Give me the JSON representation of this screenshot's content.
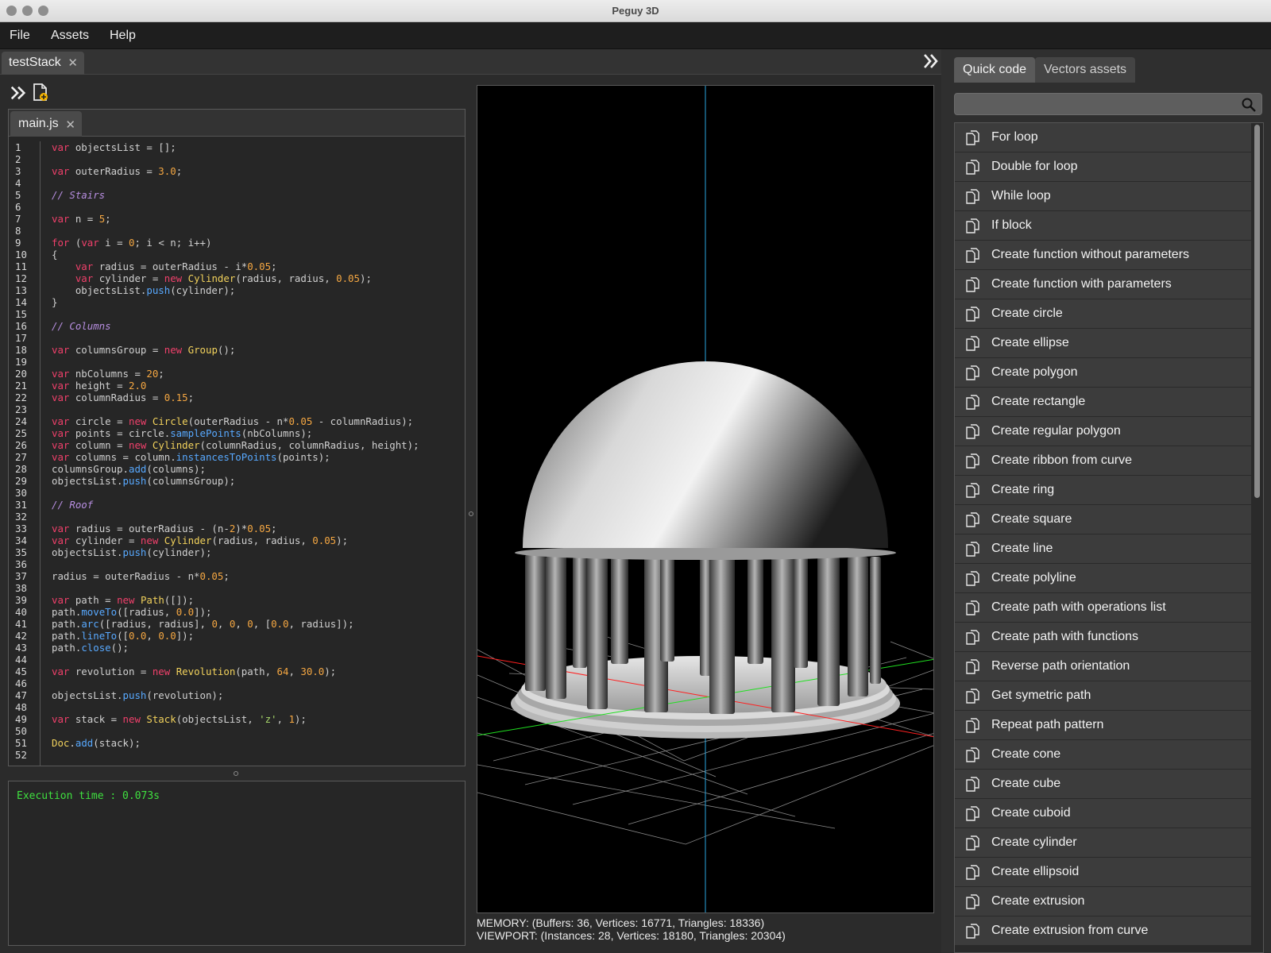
{
  "window": {
    "title": "Peguy 3D"
  },
  "menu": [
    "File",
    "Assets",
    "Help"
  ],
  "stack_tab": {
    "label": "testStack",
    "close": "✕"
  },
  "editor": {
    "file_tab": "main.js",
    "close": "✕",
    "lines": [
      [
        [
          "kw",
          "var"
        ],
        [
          "t",
          " objectsList = [];"
        ]
      ],
      [],
      [
        [
          "kw",
          "var"
        ],
        [
          "t",
          " outerRadius = "
        ],
        [
          "num",
          "3.0"
        ],
        [
          "t",
          ";"
        ]
      ],
      [],
      [
        [
          "cmt",
          "// Stairs"
        ]
      ],
      [],
      [
        [
          "kw",
          "var"
        ],
        [
          "t",
          " n = "
        ],
        [
          "num",
          "5"
        ],
        [
          "t",
          ";"
        ]
      ],
      [],
      [
        [
          "kw",
          "for"
        ],
        [
          "t",
          " ("
        ],
        [
          "kw",
          "var"
        ],
        [
          "t",
          " i = "
        ],
        [
          "num",
          "0"
        ],
        [
          "t",
          "; i < n; i++)"
        ]
      ],
      [
        [
          "t",
          "{"
        ]
      ],
      [
        [
          "t",
          "    "
        ],
        [
          "kw",
          "var"
        ],
        [
          "t",
          " radius = outerRadius - i*"
        ],
        [
          "num",
          "0.05"
        ],
        [
          "t",
          ";"
        ]
      ],
      [
        [
          "t",
          "    "
        ],
        [
          "kw",
          "var"
        ],
        [
          "t",
          " cylinder = "
        ],
        [
          "kw",
          "new"
        ],
        [
          "t",
          " "
        ],
        [
          "cls",
          "Cylinder"
        ],
        [
          "t",
          "(radius, radius, "
        ],
        [
          "num",
          "0.05"
        ],
        [
          "t",
          ");"
        ]
      ],
      [
        [
          "t",
          "    objectsList."
        ],
        [
          "fn",
          "push"
        ],
        [
          "t",
          "(cylinder);"
        ]
      ],
      [
        [
          "t",
          "}"
        ]
      ],
      [],
      [
        [
          "cmt",
          "// Columns"
        ]
      ],
      [],
      [
        [
          "kw",
          "var"
        ],
        [
          "t",
          " columnsGroup = "
        ],
        [
          "kw",
          "new"
        ],
        [
          "t",
          " "
        ],
        [
          "cls",
          "Group"
        ],
        [
          "t",
          "();"
        ]
      ],
      [],
      [
        [
          "kw",
          "var"
        ],
        [
          "t",
          " nbColumns = "
        ],
        [
          "num",
          "20"
        ],
        [
          "t",
          ";"
        ]
      ],
      [
        [
          "kw",
          "var"
        ],
        [
          "t",
          " height = "
        ],
        [
          "num",
          "2.0"
        ]
      ],
      [
        [
          "kw",
          "var"
        ],
        [
          "t",
          " columnRadius = "
        ],
        [
          "num",
          "0.15"
        ],
        [
          "t",
          ";"
        ]
      ],
      [],
      [
        [
          "kw",
          "var"
        ],
        [
          "t",
          " circle = "
        ],
        [
          "kw",
          "new"
        ],
        [
          "t",
          " "
        ],
        [
          "cls",
          "Circle"
        ],
        [
          "t",
          "(outerRadius - n*"
        ],
        [
          "num",
          "0.05"
        ],
        [
          "t",
          " - columnRadius);"
        ]
      ],
      [
        [
          "kw",
          "var"
        ],
        [
          "t",
          " points = circle."
        ],
        [
          "fn",
          "samplePoints"
        ],
        [
          "t",
          "(nbColumns);"
        ]
      ],
      [
        [
          "kw",
          "var"
        ],
        [
          "t",
          " column = "
        ],
        [
          "kw",
          "new"
        ],
        [
          "t",
          " "
        ],
        [
          "cls",
          "Cylinder"
        ],
        [
          "t",
          "(columnRadius, columnRadius, height);"
        ]
      ],
      [
        [
          "kw",
          "var"
        ],
        [
          "t",
          " columns = column."
        ],
        [
          "fn",
          "instancesToPoints"
        ],
        [
          "t",
          "(points);"
        ]
      ],
      [
        [
          "t",
          "columnsGroup."
        ],
        [
          "fn",
          "add"
        ],
        [
          "t",
          "(columns);"
        ]
      ],
      [
        [
          "t",
          "objectsList."
        ],
        [
          "fn",
          "push"
        ],
        [
          "t",
          "(columnsGroup);"
        ]
      ],
      [],
      [
        [
          "cmt",
          "// Roof"
        ]
      ],
      [],
      [
        [
          "kw",
          "var"
        ],
        [
          "t",
          " radius = outerRadius - (n-"
        ],
        [
          "num",
          "2"
        ],
        [
          "t",
          ")*"
        ],
        [
          "num",
          "0.05"
        ],
        [
          "t",
          ";"
        ]
      ],
      [
        [
          "kw",
          "var"
        ],
        [
          "t",
          " cylinder = "
        ],
        [
          "kw",
          "new"
        ],
        [
          "t",
          " "
        ],
        [
          "cls",
          "Cylinder"
        ],
        [
          "t",
          "(radius, radius, "
        ],
        [
          "num",
          "0.05"
        ],
        [
          "t",
          ");"
        ]
      ],
      [
        [
          "t",
          "objectsList."
        ],
        [
          "fn",
          "push"
        ],
        [
          "t",
          "(cylinder);"
        ]
      ],
      [],
      [
        [
          "t",
          "radius = outerRadius - n*"
        ],
        [
          "num",
          "0.05"
        ],
        [
          "t",
          ";"
        ]
      ],
      [],
      [
        [
          "kw",
          "var"
        ],
        [
          "t",
          " path = "
        ],
        [
          "kw",
          "new"
        ],
        [
          "t",
          " "
        ],
        [
          "cls",
          "Path"
        ],
        [
          "t",
          "([]);"
        ]
      ],
      [
        [
          "t",
          "path."
        ],
        [
          "fn",
          "moveTo"
        ],
        [
          "t",
          "([radius, "
        ],
        [
          "num",
          "0.0"
        ],
        [
          "t",
          "]);"
        ]
      ],
      [
        [
          "t",
          "path."
        ],
        [
          "fn",
          "arc"
        ],
        [
          "t",
          "([radius, radius], "
        ],
        [
          "num",
          "0"
        ],
        [
          "t",
          ", "
        ],
        [
          "num",
          "0"
        ],
        [
          "t",
          ", "
        ],
        [
          "num",
          "0"
        ],
        [
          "t",
          ", ["
        ],
        [
          "num",
          "0.0"
        ],
        [
          "t",
          ", radius]);"
        ]
      ],
      [
        [
          "t",
          "path."
        ],
        [
          "fn",
          "lineTo"
        ],
        [
          "t",
          "(["
        ],
        [
          "num",
          "0.0"
        ],
        [
          "t",
          ", "
        ],
        [
          "num",
          "0.0"
        ],
        [
          "t",
          "]);"
        ]
      ],
      [
        [
          "t",
          "path."
        ],
        [
          "fn",
          "close"
        ],
        [
          "t",
          "();"
        ]
      ],
      [],
      [
        [
          "kw",
          "var"
        ],
        [
          "t",
          " revolution = "
        ],
        [
          "kw",
          "new"
        ],
        [
          "t",
          " "
        ],
        [
          "cls",
          "Revolution"
        ],
        [
          "t",
          "(path, "
        ],
        [
          "num",
          "64"
        ],
        [
          "t",
          ", "
        ],
        [
          "num",
          "30.0"
        ],
        [
          "t",
          ");"
        ]
      ],
      [],
      [
        [
          "t",
          "objectsList."
        ],
        [
          "fn",
          "push"
        ],
        [
          "t",
          "(revolution);"
        ]
      ],
      [],
      [
        [
          "kw",
          "var"
        ],
        [
          "t",
          " stack = "
        ],
        [
          "kw",
          "new"
        ],
        [
          "t",
          " "
        ],
        [
          "cls",
          "Stack"
        ],
        [
          "t",
          "(objectsList, "
        ],
        [
          "str",
          "'z'"
        ],
        [
          "t",
          ", "
        ],
        [
          "num",
          "1"
        ],
        [
          "t",
          ");"
        ]
      ],
      [],
      [
        [
          "cls",
          "Doc"
        ],
        [
          "t",
          "."
        ],
        [
          "fn",
          "add"
        ],
        [
          "t",
          "(stack);"
        ]
      ],
      []
    ]
  },
  "console": {
    "text": "Execution time : 0.073s"
  },
  "viewport_stats": {
    "memory": "MEMORY: (Buffers: 36, Vertices: 16771, Triangles: 18336)",
    "viewport": "VIEWPORT: (Instances: 28, Vertices: 18180, Triangles: 20304)"
  },
  "right_panel": {
    "tabs": [
      "Quick code",
      "Vectors assets"
    ],
    "search_placeholder": "",
    "items": [
      "For loop",
      "Double for loop",
      "While loop",
      "If block",
      "Create function without parameters",
      "Create function with parameters",
      "Create circle",
      "Create ellipse",
      "Create polygon",
      "Create rectangle",
      "Create regular polygon",
      "Create ribbon from curve",
      "Create ring",
      "Create square",
      "Create line",
      "Create polyline",
      "Create path with operations list",
      "Create path with functions",
      "Reverse path orientation",
      "Get symetric path",
      "Repeat path pattern",
      "Create cone",
      "Create cube",
      "Create cuboid",
      "Create cylinder",
      "Create ellipsoid",
      "Create extrusion",
      "Create extrusion from curve"
    ]
  },
  "colors": {
    "keyword": "#f0406b",
    "number": "#f5a742",
    "class": "#f2d25c",
    "function": "#58a9ff",
    "string": "#a8d86a",
    "comment": "#b78ee0",
    "console_text": "#3fe03f",
    "axis_x": "#ff2020",
    "axis_y": "#20e020",
    "axis_z": "#2aa6e0"
  },
  "icons": [
    "double-chevron-right-icon",
    "new-file-icon",
    "search-icon",
    "copy-snippet-icon",
    "close-icon"
  ]
}
